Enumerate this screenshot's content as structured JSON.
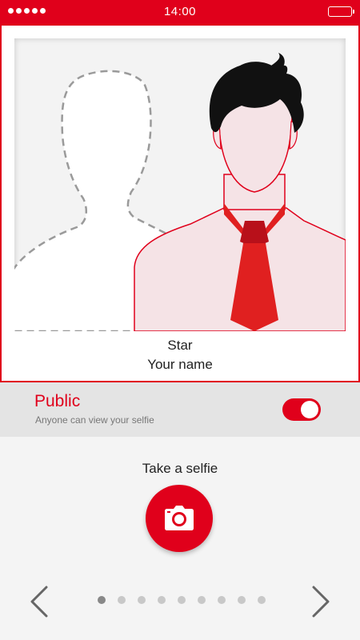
{
  "status_bar": {
    "time": "14:00"
  },
  "card": {
    "caption_star": "Star",
    "caption_name": "Your name"
  },
  "privacy": {
    "title": "Public",
    "subtitle": "Anyone can view your selfie",
    "toggle_on": true
  },
  "selfie": {
    "label": "Take a selfie"
  },
  "pager": {
    "total": 9,
    "active_index": 0
  },
  "colors": {
    "accent": "#e0001b",
    "tie": "#e02020"
  },
  "icons": {
    "signal": "signal-dots-icon",
    "battery": "battery-icon",
    "camera": "camera-icon",
    "prev": "chevron-left-icon",
    "next": "chevron-right-icon"
  }
}
